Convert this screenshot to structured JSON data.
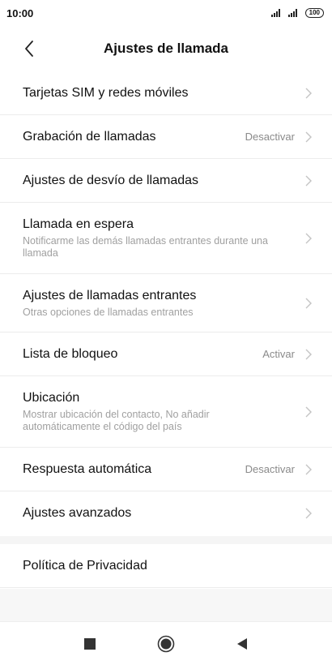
{
  "status_bar": {
    "time": "10:00",
    "battery": "100"
  },
  "header": {
    "title": "Ajustes de llamada",
    "back_icon": "chevron-left-icon"
  },
  "items": [
    {
      "title": "Tarjetas SIM y redes móviles",
      "subtitle": "",
      "value": ""
    },
    {
      "title": "Grabación de llamadas",
      "subtitle": "",
      "value": "Desactivar"
    },
    {
      "title": "Ajustes de desvío de llamadas",
      "subtitle": "",
      "value": ""
    },
    {
      "title": "Llamada en espera",
      "subtitle": "Notificarme las demás llamadas entrantes durante una llamada",
      "value": ""
    },
    {
      "title": "Ajustes de llamadas entrantes",
      "subtitle": "Otras opciones de llamadas entrantes",
      "value": ""
    },
    {
      "title": "Lista de bloqueo",
      "subtitle": "",
      "value": "Activar"
    },
    {
      "title": "Ubicación",
      "subtitle": "Mostrar ubicación del contacto, No añadir automáticamente el código del país",
      "value": ""
    },
    {
      "title": "Respuesta automática",
      "subtitle": "",
      "value": "Desactivar"
    },
    {
      "title": "Ajustes avanzados",
      "subtitle": "",
      "value": ""
    }
  ],
  "privacy": {
    "title": "Política de Privacidad"
  },
  "nav_bar": {
    "recents_icon": "square-icon",
    "home_icon": "circle-home-icon",
    "back_icon": "triangle-back-icon"
  },
  "colors": {
    "text": "#111111",
    "subtext": "#a0a0a0",
    "value": "#8a8a8a",
    "chevron": "#c4c4c4",
    "divider": "#ececec",
    "band": "#f5f5f5"
  }
}
